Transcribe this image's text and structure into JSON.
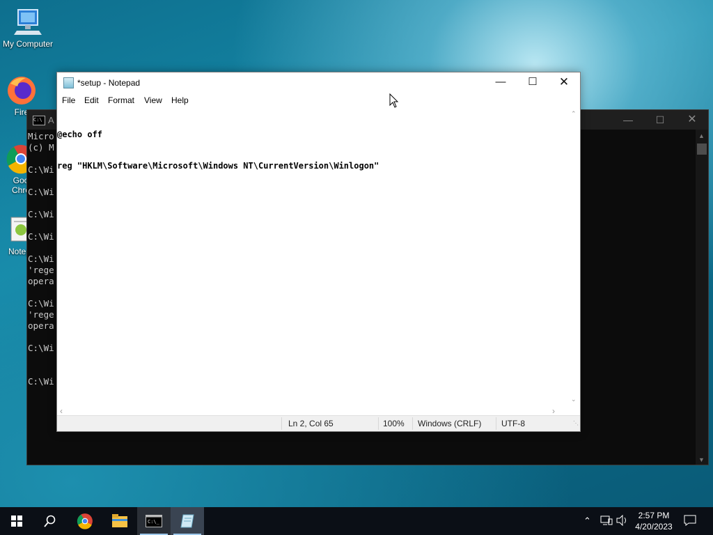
{
  "desktop": {
    "icons": [
      {
        "label": "My Computer",
        "icon": "computer-icon"
      },
      {
        "label": "Fire",
        "icon": "firefox-icon"
      },
      {
        "label": "Goo",
        "label2": "Chro",
        "icon": "chrome-icon"
      },
      {
        "label": "Notep",
        "icon": "notepad-icon"
      }
    ]
  },
  "cmd": {
    "title": "A",
    "lines": [
      "Micro",
      "(c) M",
      "",
      "C:\\Wi",
      "",
      "C:\\Wi",
      "",
      "C:\\Wi",
      "",
      "C:\\Wi",
      "",
      "C:\\Wi",
      "'rege",
      "opera",
      "",
      "C:\\Wi",
      "'rege",
      "opera",
      "",
      "C:\\Wi",
      "",
      "",
      "C:\\Wi"
    ]
  },
  "notepad": {
    "title": "*setup - Notepad",
    "menu": [
      "File",
      "Edit",
      "Format",
      "View",
      "Help"
    ],
    "content_lines": [
      "@echo off",
      "reg \"HKLM\\Software\\Microsoft\\Windows NT\\CurrentVersion\\Winlogon\""
    ],
    "status": {
      "position": "Ln 2, Col 65",
      "zoom": "100%",
      "line_ending": "Windows (CRLF)",
      "encoding": "UTF-8"
    }
  },
  "taskbar": {
    "apps": [
      "start-icon",
      "search-icon",
      "chrome-icon",
      "file-explorer-icon",
      "cmd-icon",
      "notepad-icon"
    ],
    "time": "2:57 PM",
    "date": "4/20/2023"
  },
  "colors": {
    "taskbar_bg": "#0b0f16",
    "cmd_bg": "#0c0c0c",
    "active_underline": "#9fc9ec"
  }
}
